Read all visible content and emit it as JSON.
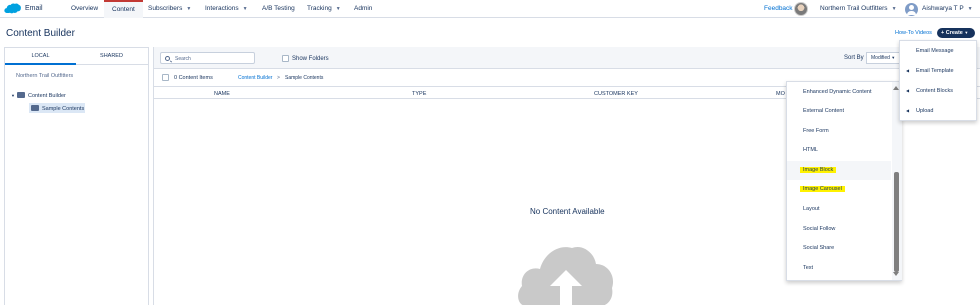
{
  "nav": {
    "app_name": "Email",
    "items": [
      {
        "label": "Overview",
        "dropdown": false
      },
      {
        "label": "Content",
        "dropdown": false,
        "active": true
      },
      {
        "label": "Subscribers",
        "dropdown": true
      },
      {
        "label": "Interactions",
        "dropdown": true
      },
      {
        "label": "A/B Testing",
        "dropdown": false
      },
      {
        "label": "Tracking",
        "dropdown": true
      },
      {
        "label": "Admin",
        "dropdown": false
      }
    ],
    "feedback": "Feedback",
    "org": "Northern Trail Outfitters",
    "user": "Aishwarya T P",
    "colors": {
      "link": "#0070d2",
      "active_border": "#c23934",
      "brand_blue": "#00a1e0",
      "dark": "#16325c"
    }
  },
  "header": {
    "title": "Content Builder",
    "how_to": "How-To Videos",
    "create": "Create"
  },
  "left": {
    "tabs": [
      "LOCAL",
      "SHARED"
    ],
    "org_name": "Northern Trail Outfitters",
    "tree": [
      {
        "label": "Content Builder",
        "expanded": true
      },
      {
        "label": "Sample Contents",
        "selected": true
      }
    ]
  },
  "toolbar": {
    "search_placeholder": "Search",
    "show_folders": "Show Folders",
    "sort_by": "Sort By",
    "sort_value": "Modified"
  },
  "subbar": {
    "count": "0 Content Items",
    "breadcrumb_root": "Content Builder",
    "breadcrumb_sep": ">",
    "breadcrumb_current": "Sample Contents"
  },
  "table": {
    "columns": [
      "NAME",
      "TYPE",
      "CUSTOMER KEY",
      "MO"
    ]
  },
  "empty_state": "No Content Available",
  "submenu": {
    "items": [
      {
        "label": "Enhanced Dynamic Content"
      },
      {
        "label": "External Content"
      },
      {
        "label": "Free Form"
      },
      {
        "label": "HTML"
      },
      {
        "label": "Image Block",
        "highlight": true,
        "hover": true
      },
      {
        "label": "Image Carousel",
        "highlight": true
      },
      {
        "label": "Layout"
      },
      {
        "label": "Social Follow"
      },
      {
        "label": "Social Share"
      },
      {
        "label": "Text"
      }
    ]
  },
  "create_menu": {
    "items": [
      {
        "label": "Email Message",
        "arrow": false
      },
      {
        "label": "Email Template",
        "arrow": true
      },
      {
        "label": "Content Blocks",
        "arrow": true
      },
      {
        "label": "Upload",
        "arrow": true
      }
    ]
  }
}
